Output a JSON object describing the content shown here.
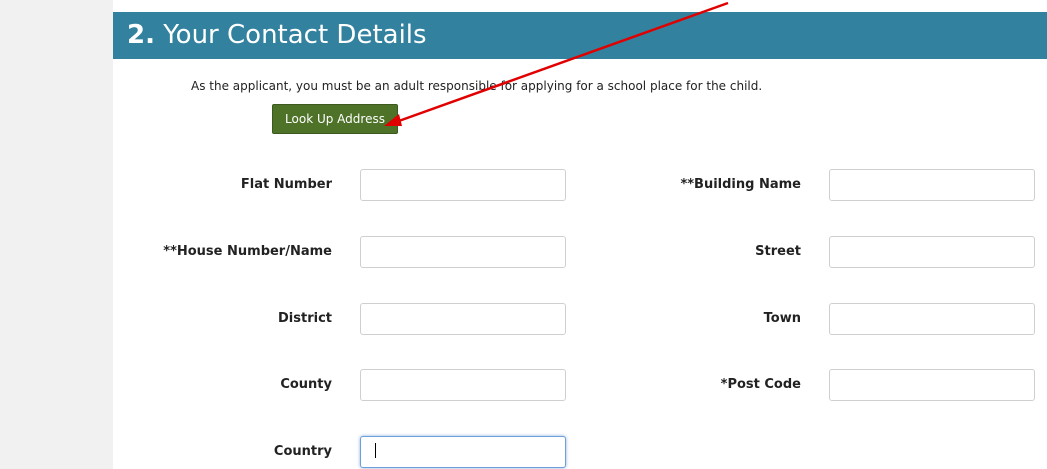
{
  "section": {
    "number": "2.",
    "title": "Your Contact Details",
    "intro": "As the applicant, you must be an adult responsible for applying for a school place for the child."
  },
  "lookup_button": {
    "label": "Look Up Address"
  },
  "fields": {
    "flat_number": {
      "label": "Flat Number",
      "value": ""
    },
    "building_name": {
      "label": "**Building Name",
      "value": ""
    },
    "house_number": {
      "label": "**House Number/Name",
      "value": ""
    },
    "street": {
      "label": "Street",
      "value": ""
    },
    "district": {
      "label": "District",
      "value": ""
    },
    "town": {
      "label": "Town",
      "value": ""
    },
    "county": {
      "label": "County",
      "value": ""
    },
    "post_code": {
      "label": "*Post Code",
      "value": ""
    },
    "country": {
      "label": "Country",
      "value": ""
    }
  },
  "colors": {
    "header": "#32819e",
    "button": "#4d7228",
    "annotation_arrow": "#e00000"
  },
  "annotation": {
    "type": "arrow",
    "points_to": "lookup-address-button"
  }
}
